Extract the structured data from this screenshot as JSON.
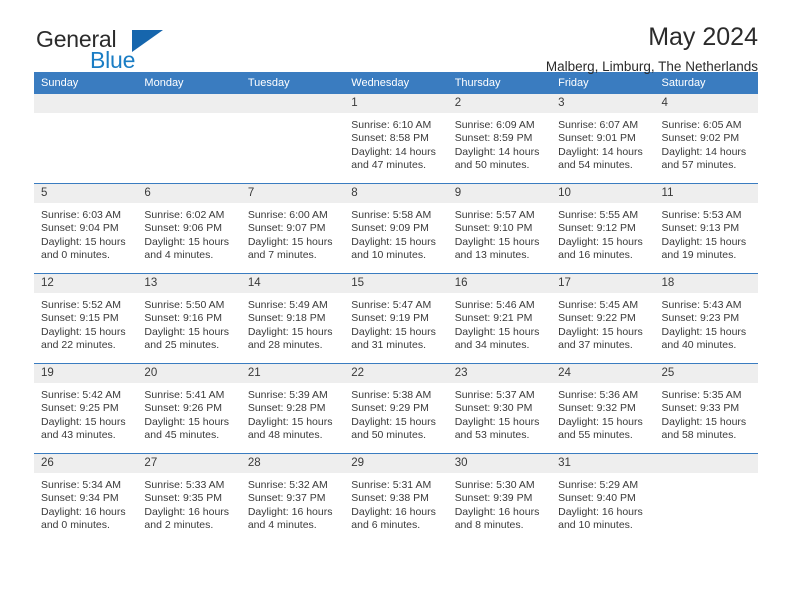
{
  "brand": {
    "name_top": "General",
    "name_bottom": "Blue",
    "flag_icon": "triangle-flag-icon",
    "accent_color": "#1a7dc4"
  },
  "header": {
    "title": "May 2024",
    "subtitle": "Malberg, Limburg, The Netherlands"
  },
  "calendar": {
    "header_bg": "#3a7cc0",
    "daynum_bg": "#eeeeee",
    "weekday_labels": [
      "Sunday",
      "Monday",
      "Tuesday",
      "Wednesday",
      "Thursday",
      "Friday",
      "Saturday"
    ],
    "labels": {
      "sunrise": "Sunrise:",
      "sunset": "Sunset:",
      "daylight": "Daylight:"
    },
    "weeks": [
      [
        {
          "day": "",
          "empty": true
        },
        {
          "day": "",
          "empty": true
        },
        {
          "day": "",
          "empty": true
        },
        {
          "day": "1",
          "sunrise": "Sunrise: 6:10 AM",
          "sunset": "Sunset: 8:58 PM",
          "daylight_1": "Daylight: 14 hours",
          "daylight_2": "and 47 minutes."
        },
        {
          "day": "2",
          "sunrise": "Sunrise: 6:09 AM",
          "sunset": "Sunset: 8:59 PM",
          "daylight_1": "Daylight: 14 hours",
          "daylight_2": "and 50 minutes."
        },
        {
          "day": "3",
          "sunrise": "Sunrise: 6:07 AM",
          "sunset": "Sunset: 9:01 PM",
          "daylight_1": "Daylight: 14 hours",
          "daylight_2": "and 54 minutes."
        },
        {
          "day": "4",
          "sunrise": "Sunrise: 6:05 AM",
          "sunset": "Sunset: 9:02 PM",
          "daylight_1": "Daylight: 14 hours",
          "daylight_2": "and 57 minutes."
        }
      ],
      [
        {
          "day": "5",
          "sunrise": "Sunrise: 6:03 AM",
          "sunset": "Sunset: 9:04 PM",
          "daylight_1": "Daylight: 15 hours",
          "daylight_2": "and 0 minutes."
        },
        {
          "day": "6",
          "sunrise": "Sunrise: 6:02 AM",
          "sunset": "Sunset: 9:06 PM",
          "daylight_1": "Daylight: 15 hours",
          "daylight_2": "and 4 minutes."
        },
        {
          "day": "7",
          "sunrise": "Sunrise: 6:00 AM",
          "sunset": "Sunset: 9:07 PM",
          "daylight_1": "Daylight: 15 hours",
          "daylight_2": "and 7 minutes."
        },
        {
          "day": "8",
          "sunrise": "Sunrise: 5:58 AM",
          "sunset": "Sunset: 9:09 PM",
          "daylight_1": "Daylight: 15 hours",
          "daylight_2": "and 10 minutes."
        },
        {
          "day": "9",
          "sunrise": "Sunrise: 5:57 AM",
          "sunset": "Sunset: 9:10 PM",
          "daylight_1": "Daylight: 15 hours",
          "daylight_2": "and 13 minutes."
        },
        {
          "day": "10",
          "sunrise": "Sunrise: 5:55 AM",
          "sunset": "Sunset: 9:12 PM",
          "daylight_1": "Daylight: 15 hours",
          "daylight_2": "and 16 minutes."
        },
        {
          "day": "11",
          "sunrise": "Sunrise: 5:53 AM",
          "sunset": "Sunset: 9:13 PM",
          "daylight_1": "Daylight: 15 hours",
          "daylight_2": "and 19 minutes."
        }
      ],
      [
        {
          "day": "12",
          "sunrise": "Sunrise: 5:52 AM",
          "sunset": "Sunset: 9:15 PM",
          "daylight_1": "Daylight: 15 hours",
          "daylight_2": "and 22 minutes."
        },
        {
          "day": "13",
          "sunrise": "Sunrise: 5:50 AM",
          "sunset": "Sunset: 9:16 PM",
          "daylight_1": "Daylight: 15 hours",
          "daylight_2": "and 25 minutes."
        },
        {
          "day": "14",
          "sunrise": "Sunrise: 5:49 AM",
          "sunset": "Sunset: 9:18 PM",
          "daylight_1": "Daylight: 15 hours",
          "daylight_2": "and 28 minutes."
        },
        {
          "day": "15",
          "sunrise": "Sunrise: 5:47 AM",
          "sunset": "Sunset: 9:19 PM",
          "daylight_1": "Daylight: 15 hours",
          "daylight_2": "and 31 minutes."
        },
        {
          "day": "16",
          "sunrise": "Sunrise: 5:46 AM",
          "sunset": "Sunset: 9:21 PM",
          "daylight_1": "Daylight: 15 hours",
          "daylight_2": "and 34 minutes."
        },
        {
          "day": "17",
          "sunrise": "Sunrise: 5:45 AM",
          "sunset": "Sunset: 9:22 PM",
          "daylight_1": "Daylight: 15 hours",
          "daylight_2": "and 37 minutes."
        },
        {
          "day": "18",
          "sunrise": "Sunrise: 5:43 AM",
          "sunset": "Sunset: 9:23 PM",
          "daylight_1": "Daylight: 15 hours",
          "daylight_2": "and 40 minutes."
        }
      ],
      [
        {
          "day": "19",
          "sunrise": "Sunrise: 5:42 AM",
          "sunset": "Sunset: 9:25 PM",
          "daylight_1": "Daylight: 15 hours",
          "daylight_2": "and 43 minutes."
        },
        {
          "day": "20",
          "sunrise": "Sunrise: 5:41 AM",
          "sunset": "Sunset: 9:26 PM",
          "daylight_1": "Daylight: 15 hours",
          "daylight_2": "and 45 minutes."
        },
        {
          "day": "21",
          "sunrise": "Sunrise: 5:39 AM",
          "sunset": "Sunset: 9:28 PM",
          "daylight_1": "Daylight: 15 hours",
          "daylight_2": "and 48 minutes."
        },
        {
          "day": "22",
          "sunrise": "Sunrise: 5:38 AM",
          "sunset": "Sunset: 9:29 PM",
          "daylight_1": "Daylight: 15 hours",
          "daylight_2": "and 50 minutes."
        },
        {
          "day": "23",
          "sunrise": "Sunrise: 5:37 AM",
          "sunset": "Sunset: 9:30 PM",
          "daylight_1": "Daylight: 15 hours",
          "daylight_2": "and 53 minutes."
        },
        {
          "day": "24",
          "sunrise": "Sunrise: 5:36 AM",
          "sunset": "Sunset: 9:32 PM",
          "daylight_1": "Daylight: 15 hours",
          "daylight_2": "and 55 minutes."
        },
        {
          "day": "25",
          "sunrise": "Sunrise: 5:35 AM",
          "sunset": "Sunset: 9:33 PM",
          "daylight_1": "Daylight: 15 hours",
          "daylight_2": "and 58 minutes."
        }
      ],
      [
        {
          "day": "26",
          "sunrise": "Sunrise: 5:34 AM",
          "sunset": "Sunset: 9:34 PM",
          "daylight_1": "Daylight: 16 hours",
          "daylight_2": "and 0 minutes."
        },
        {
          "day": "27",
          "sunrise": "Sunrise: 5:33 AM",
          "sunset": "Sunset: 9:35 PM",
          "daylight_1": "Daylight: 16 hours",
          "daylight_2": "and 2 minutes."
        },
        {
          "day": "28",
          "sunrise": "Sunrise: 5:32 AM",
          "sunset": "Sunset: 9:37 PM",
          "daylight_1": "Daylight: 16 hours",
          "daylight_2": "and 4 minutes."
        },
        {
          "day": "29",
          "sunrise": "Sunrise: 5:31 AM",
          "sunset": "Sunset: 9:38 PM",
          "daylight_1": "Daylight: 16 hours",
          "daylight_2": "and 6 minutes."
        },
        {
          "day": "30",
          "sunrise": "Sunrise: 5:30 AM",
          "sunset": "Sunset: 9:39 PM",
          "daylight_1": "Daylight: 16 hours",
          "daylight_2": "and 8 minutes."
        },
        {
          "day": "31",
          "sunrise": "Sunrise: 5:29 AM",
          "sunset": "Sunset: 9:40 PM",
          "daylight_1": "Daylight: 16 hours",
          "daylight_2": "and 10 minutes."
        },
        {
          "day": "",
          "empty": true
        }
      ]
    ]
  }
}
